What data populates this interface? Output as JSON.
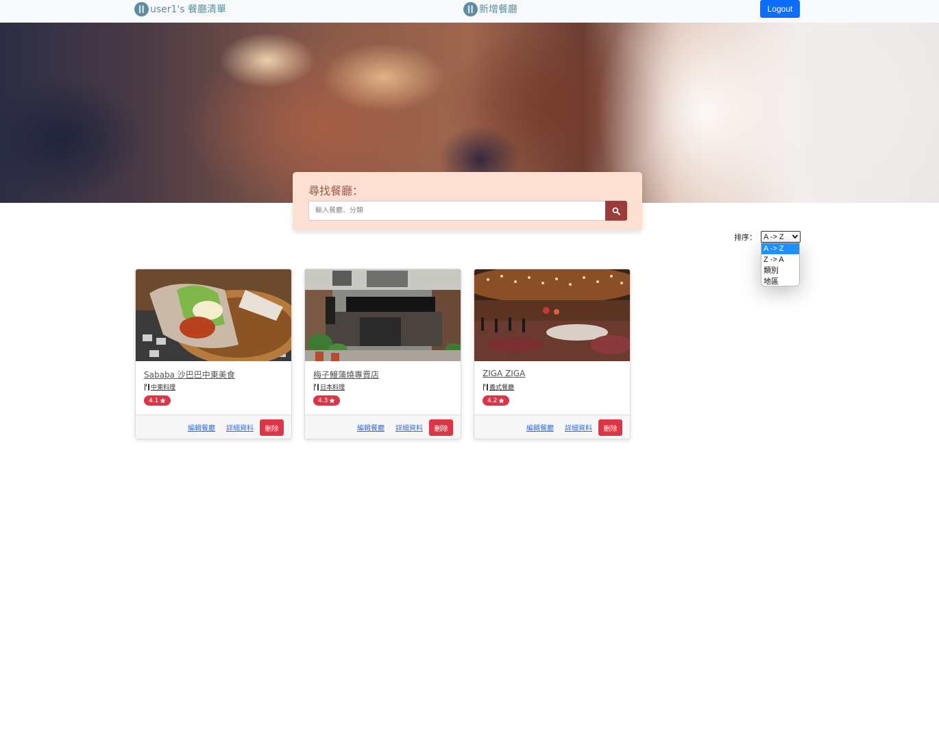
{
  "navbar": {
    "brand": "user1's 餐廳清單",
    "add_link": "新增餐廳",
    "logout": "Logout"
  },
  "search": {
    "title": "尋找餐廳：",
    "placeholder": "輸入餐廳、分類",
    "button_icon": "search-icon"
  },
  "sort": {
    "label": "排序：",
    "selected": "A -> Z",
    "options": [
      "A -> Z",
      "Z -> A",
      "類別",
      "地區"
    ]
  },
  "restaurants": [
    {
      "name": "Sababa 沙巴巴中東美食",
      "category": "中東料理",
      "rating": "4.1"
    },
    {
      "name": "梅子鰻蒲燒專賣店",
      "category": "日本料理",
      "rating": "4.3"
    },
    {
      "name": "ZIGA ZIGA",
      "category": "義式餐廳",
      "rating": "4.2"
    }
  ],
  "card_actions": {
    "edit": "編輯餐廳",
    "detail": "詳細資料",
    "delete": "刪除"
  },
  "colors": {
    "navbar_bg": "#f8f9fa",
    "brand_color": "#5a8ea0",
    "logout_bg": "#0d6efd",
    "search_panel_bg": "#fce0d2",
    "search_btn_bg": "#9b3b3b",
    "badge_bg": "#dc3545",
    "delete_bg": "#dc3545"
  }
}
